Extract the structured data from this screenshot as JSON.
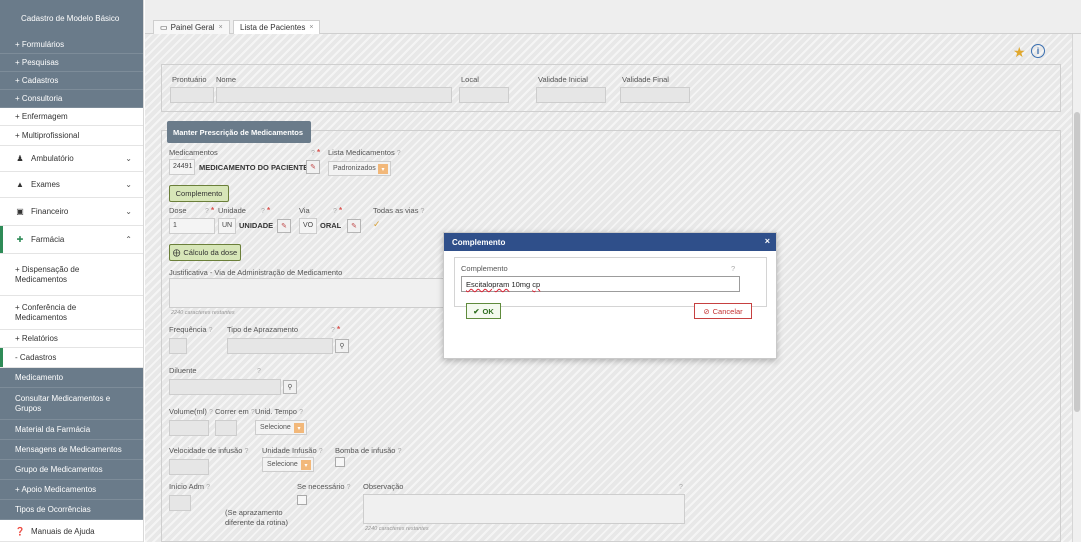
{
  "sidebar": {
    "title": "Cadastro de Modelo Básico",
    "items": [
      {
        "label": "+ Formulários"
      },
      {
        "label": "+ Pesquisas"
      },
      {
        "label": "+ Cadastros"
      },
      {
        "label": "+ Consultoria"
      },
      {
        "label": "+ Enfermagem"
      },
      {
        "label": "+ Multiprofissional"
      },
      {
        "label": "Ambulatório"
      },
      {
        "label": "Exames"
      },
      {
        "label": "Financeiro"
      },
      {
        "label": "Farmácia"
      },
      {
        "label": "+ Dispensação de\nMedicamentos"
      },
      {
        "label": "+ Conferência de\nMedicamentos"
      },
      {
        "label": "+ Relatórios"
      },
      {
        "label": "- Cadastros"
      },
      {
        "label": "Medicamento"
      },
      {
        "label": "Consultar Medicamentos e\nGrupos"
      },
      {
        "label": "Material da Farmácia"
      },
      {
        "label": "Mensagens de Medicamentos"
      },
      {
        "label": "Grupo de Medicamentos"
      },
      {
        "label": "+ Apoio Medicamentos"
      },
      {
        "label": "Tipos de Ocorrências"
      },
      {
        "label": "Manuais de Ajuda"
      }
    ]
  },
  "tabs": [
    {
      "label": "Painel Geral",
      "close": "×"
    },
    {
      "label": "Lista de Pacientes",
      "close": "×"
    }
  ],
  "patient": {
    "prontuario_label": "Prontuário",
    "nome_label": "Nome",
    "local_label": "Local",
    "validade_inicial_label": "Validade Inicial",
    "validade_final_label": "Validade Final"
  },
  "form": {
    "section_title": "Manter Prescrição de Medicamentos",
    "medicamentos_label": "Medicamentos",
    "medicamento_code": "24491",
    "medicamento_name": "MEDICAMENTO DO PACIENTE",
    "lista_label": "Lista Medicamentos",
    "lista_value": "Padronizados",
    "complemento_button": "Complemento",
    "dose_label": "Dose",
    "dose_value": "1",
    "unidade_label": "Unidade",
    "unidade_code": "UN",
    "unidade_name": "UNIDADE",
    "via_label": "Via",
    "via_code": "VO",
    "via_name": "ORAL",
    "todas_vias_label": "Todas as vias",
    "calculo_button": "Cálculo da dose",
    "justificativa_label": "Justificativa - Via de Administração de Medicamento",
    "chars_left_1": "2240 caracteres restantes",
    "frequencia_label": "Frequência",
    "tipo_aprazamento_label": "Tipo de Aprazamento",
    "diluente_label": "Diluente",
    "volume_label": "Volume(ml)",
    "correr_em_label": "Correr em",
    "unid_tempo_label": "Unid. Tempo",
    "selecione_1": "Selecione",
    "velocidade_label": "Velocidade de infusão",
    "unidade_infusao_label": "Unidade Infusão",
    "bomba_label": "Bomba de infusão",
    "selecione_2": "Selecione",
    "inicio_adm_label": "Início Adm",
    "se_necessario_label": "Se necessário",
    "observacao_label": "Observação",
    "se_aprazamento_note": "(Se aprazamento\ndiferente da rotina)",
    "chars_left_2": "2240 caracteres restantes",
    "qm": "?",
    "req": "*"
  },
  "modal": {
    "title": "Complemento",
    "close": "×",
    "field_label": "Complemento",
    "field_qm": "?",
    "value_prefix": "Escitalopram",
    "value_middle": " 10mg ",
    "value_suffix": "cp",
    "ok_label": "OK",
    "cancel_label": "Cancelar"
  },
  "colors": {
    "sidebar_dark": "#6a7b8a",
    "modal_header": "#2f4f8a",
    "ok_green": "#2f6e1f",
    "cancel_red": "#c43333",
    "star": "#e0a82e",
    "info": "#3a6fb0"
  }
}
